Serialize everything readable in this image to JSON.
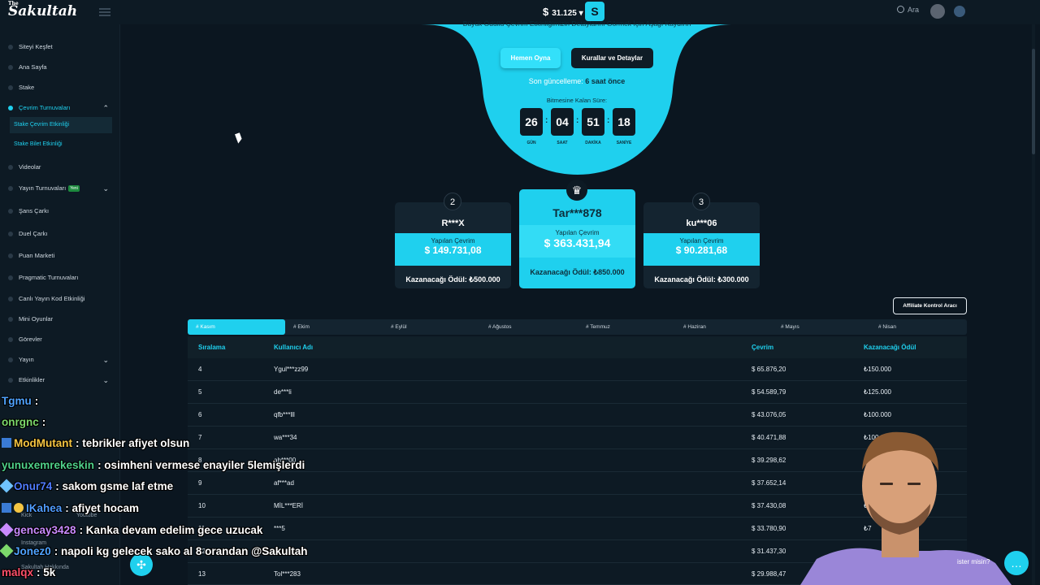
{
  "header": {
    "logo_small": "The",
    "logo": "Sakultah",
    "balance_currency": "$",
    "balance": "31.125",
    "search_label": "Ara",
    "brand_badge": "S"
  },
  "sidebar": {
    "items": [
      {
        "label": "Siteyi Keşfet"
      },
      {
        "label": "Ana Sayfa"
      },
      {
        "label": "Stake"
      },
      {
        "label": "Çevrim Turnuvaları"
      },
      {
        "label": "Videolar"
      },
      {
        "label": "Yayın Turnuvaları",
        "badge": "Yeni"
      },
      {
        "label": "Şans Çarkı"
      },
      {
        "label": "Duel Çarkı"
      },
      {
        "label": "Puan Marketi"
      },
      {
        "label": "Pragmatic Turnuvaları"
      },
      {
        "label": "Canlı Yayın Kod Etkinliği"
      },
      {
        "label": "Mini Oyunlar"
      },
      {
        "label": "Görevler"
      },
      {
        "label": "Yayın"
      },
      {
        "label": "Etkinlikler"
      }
    ],
    "subitems": [
      "Stake Çevrim Etkinliği",
      "Stake Bilet Etkinliği"
    ],
    "footer": {
      "kick": "Kick",
      "youtube": "Youtube",
      "instagram": "Instagram",
      "about": "Sakultah Hakkında"
    }
  },
  "hero": {
    "subtitle": "Büyük Ödüllü Çevrim Etkinliğimizin Detaylarını Görmek İçin Aşağı Kaydırın",
    "play_button": "Hemen Oyna",
    "rules_button": "Kurallar ve Detaylar",
    "updated_prefix": "Son güncelleme:",
    "updated_value": "6 saat önce",
    "remaining_label": "Bitmesine Kalan Süre:",
    "countdown": [
      {
        "value": "26",
        "label": "GÜN"
      },
      {
        "value": "04",
        "label": "SAAT"
      },
      {
        "value": "51",
        "label": "DAKİKA"
      },
      {
        "value": "18",
        "label": "SANİYE"
      }
    ]
  },
  "podium": {
    "wager_label": "Yapılan Çevrim",
    "prize_label": "Kazanacağı Ödül:",
    "first": {
      "user": "Tar***878",
      "wager": "$ 363.431,94",
      "prize": "₺850.000"
    },
    "second": {
      "rank": "2",
      "user": "R***X",
      "wager": "$ 149.731,08",
      "prize": "₺500.000"
    },
    "third": {
      "rank": "3",
      "user": "ku***06",
      "wager": "$ 90.281,68",
      "prize": "₺300.000"
    }
  },
  "affiliate_button": "Affiliate Kontrol Aracı",
  "tabs": [
    "# Kasım",
    "# Ekim",
    "# Eylül",
    "# Ağustos",
    "# Temmuz",
    "# Haziran",
    "# Mayıs",
    "# Nisan"
  ],
  "table": {
    "headers": [
      "Sıralama",
      "Kullanıcı Adı",
      "Çevrim",
      "Kazanacağı Ödül"
    ],
    "rows": [
      [
        "4",
        "Ygul***zz99",
        "$ 65.876,20",
        "₺150.000"
      ],
      [
        "5",
        "de***li",
        "$ 54.589,79",
        "₺125.000"
      ],
      [
        "6",
        "qfb***lll",
        "$ 43.076,05",
        "₺100.000"
      ],
      [
        "7",
        "wa***34",
        "$ 40.471,88",
        "₺100.000"
      ],
      [
        "8",
        "ah***00",
        "$ 39.298,62",
        "₺"
      ],
      [
        "9",
        "af***ad",
        "$ 37.652,14",
        "₺"
      ],
      [
        "10",
        "MİL***ERİ",
        "$ 37.430,08",
        "₺"
      ],
      [
        "11",
        "***5",
        "$ 33.780,90",
        "₺7"
      ],
      [
        "12",
        "",
        "$ 31.437,30",
        ""
      ],
      [
        "13",
        "Tol***283",
        "$ 29.988,47",
        "₺"
      ]
    ]
  },
  "chat": [
    {
      "user": "Tgmu",
      "msg": ": ",
      "color": "#4fa3ff"
    },
    {
      "user": "onrgnc",
      "msg": ": ",
      "color": "#7cd96b"
    },
    {
      "user": "ModMutant",
      "msg": ": tebrikler afiyet olsun",
      "color": "#f5c542"
    },
    {
      "user": "yunuxemrekeskin",
      "msg": ": osimheni vermese enayiler 5lemişlerdi",
      "color": "#4fd18a"
    },
    {
      "user": "Onur74",
      "msg": ": sakom gsme laf etme",
      "color": "#4f7cff"
    },
    {
      "user": "IKahea",
      "msg": ": afiyet hocam",
      "color": "#4f9cff"
    },
    {
      "user": "gencay3428",
      "msg": ": Kanka devam edelim gece uzucak",
      "color": "#c98bff"
    },
    {
      "user": "Jonez0",
      "msg": ": napoli kg gelecek sako al 8 orandan @Sakultah",
      "color": "#4fa3ff"
    },
    {
      "user": "malqx",
      "msg": ": 5k",
      "color": "#ff4f6a"
    }
  ],
  "support_text": "ister misin?",
  "colors": {
    "accent": "#1fd0ee",
    "background": "#0b1620",
    "panel": "#142430"
  }
}
